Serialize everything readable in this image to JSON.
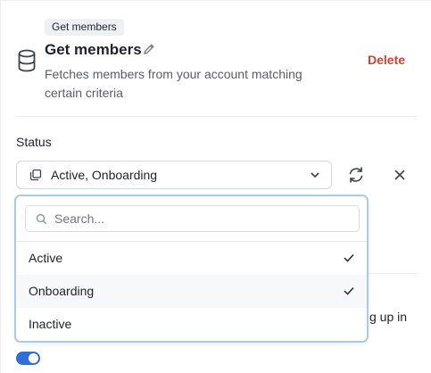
{
  "block": {
    "tag": "Get members",
    "title": "Get members",
    "description": "Fetches members from your account matching certain criteria",
    "delete_label": "Delete"
  },
  "status": {
    "label": "Status",
    "selected_value": "Active, Onboarding"
  },
  "dropdown": {
    "search_placeholder": "Search...",
    "options": [
      {
        "label": "Active",
        "checked": true
      },
      {
        "label": "Onboarding",
        "checked": true
      },
      {
        "label": "Inactive",
        "checked": false
      }
    ]
  },
  "background_fragment": "g up in",
  "toggle": {
    "on": true
  },
  "colors": {
    "accent": "#2f6fd6",
    "danger": "#d1432e",
    "dropdown_border": "#a9cbe6"
  }
}
